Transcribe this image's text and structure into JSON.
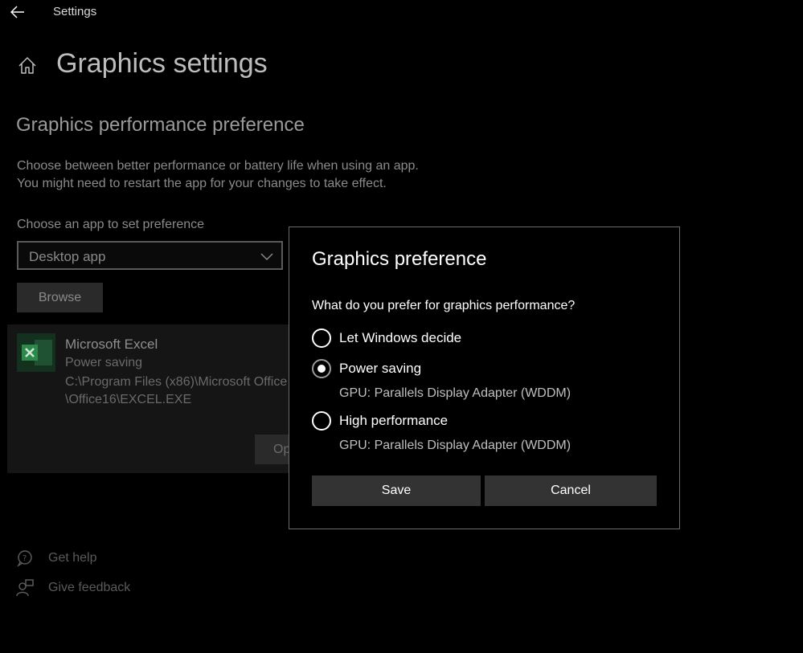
{
  "window": {
    "title": "Settings"
  },
  "header": {
    "title": "Graphics settings"
  },
  "section": {
    "title": "Graphics performance preference",
    "description_line1": "Choose between better performance or battery life when using an app.",
    "description_line2": "You might need to restart the app for your changes to take effect.",
    "choose_label": "Choose an app to set preference",
    "dropdown_value": "Desktop app",
    "browse_label": "Browse"
  },
  "app": {
    "name": "Microsoft Excel",
    "preference": "Power saving",
    "path_line1": "C:\\Program Files (x86)\\Microsoft Office",
    "path_line2": "\\Office16\\EXCEL.EXE",
    "options_label": "Op"
  },
  "footer": {
    "help_label": "Get help",
    "feedback_label": "Give feedback"
  },
  "dialog": {
    "title": "Graphics preference",
    "question": "What do you prefer for graphics performance?",
    "options": [
      {
        "label": "Let Windows decide",
        "checked": false
      },
      {
        "label": "Power saving",
        "checked": true,
        "gpu": "GPU: Parallels Display Adapter (WDDM)"
      },
      {
        "label": "High performance",
        "checked": false,
        "gpu": "GPU: Parallels Display Adapter (WDDM)"
      }
    ],
    "save_label": "Save",
    "cancel_label": "Cancel"
  },
  "colors": {
    "background": "#000000",
    "button": "#333333",
    "excel_green": "#2b8a4a"
  }
}
